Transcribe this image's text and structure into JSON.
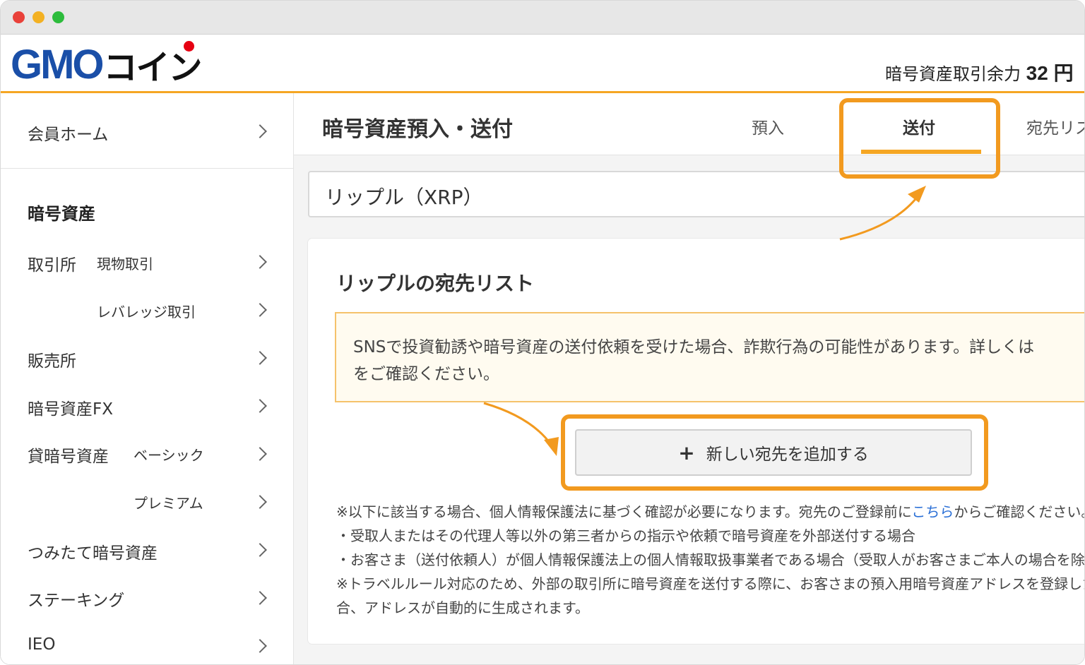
{
  "header": {
    "logo_text": "GMO",
    "logo_kana": "コイン",
    "balance_label": "暗号資産取引余力",
    "balance_value": "32 円"
  },
  "sidebar": {
    "member_home": "会員ホーム",
    "section_title": "暗号資産",
    "exchange_label": "取引所",
    "exchange_spot": "現物取引",
    "exchange_leverage": "レバレッジ取引",
    "sales": "販売所",
    "fx": "暗号資産FX",
    "lending_label": "貸暗号資産",
    "lending_basic": "ベーシック",
    "lending_premium": "プレミアム",
    "tsumitate": "つみたて暗号資産",
    "staking": "ステーキング",
    "ieo": "IEO"
  },
  "main": {
    "page_title": "暗号資産預入・送付",
    "tabs": {
      "deposit": "預入",
      "send": "送付",
      "address_list": "宛先リスト"
    },
    "currency_select": "リップル（XRP）",
    "card_title": "リップルの宛先リスト",
    "notice_line1": "SNSで投資勧誘や暗号資産の送付依頼を受けた場合、詐欺行為の可能性があります。詳しくは",
    "notice_line2": "をご確認ください。",
    "add_button_plus": "+",
    "add_button_label": "新しい宛先を追加する",
    "note1_before": "※以下に該当する場合、個人情報保護法に基づく確認が必要になります。宛先のご登録前に",
    "note1_link": "こちら",
    "note1_after": "からご確認ください。",
    "note2": "・受取人またはその代理人等以外の第三者からの指示や依頼で暗号資産を外部送付する場合",
    "note3": "・お客さま（送付依頼人）が個人情報保護法上の個人情報取扱事業者である場合（受取人がお客さまご本人の場合を除く）",
    "note4": "※トラベルルール対応のため、外部の取引所に暗号資産を送付する際に、お客さまの預入用暗号資産アドレスを登録した場",
    "note5": "合、アドレスが自動的に生成されます。"
  },
  "colors": {
    "accent": "#f5a623",
    "highlight": "#f29a1f",
    "logo_blue": "#1a4fa8",
    "link": "#2a6fd6"
  }
}
